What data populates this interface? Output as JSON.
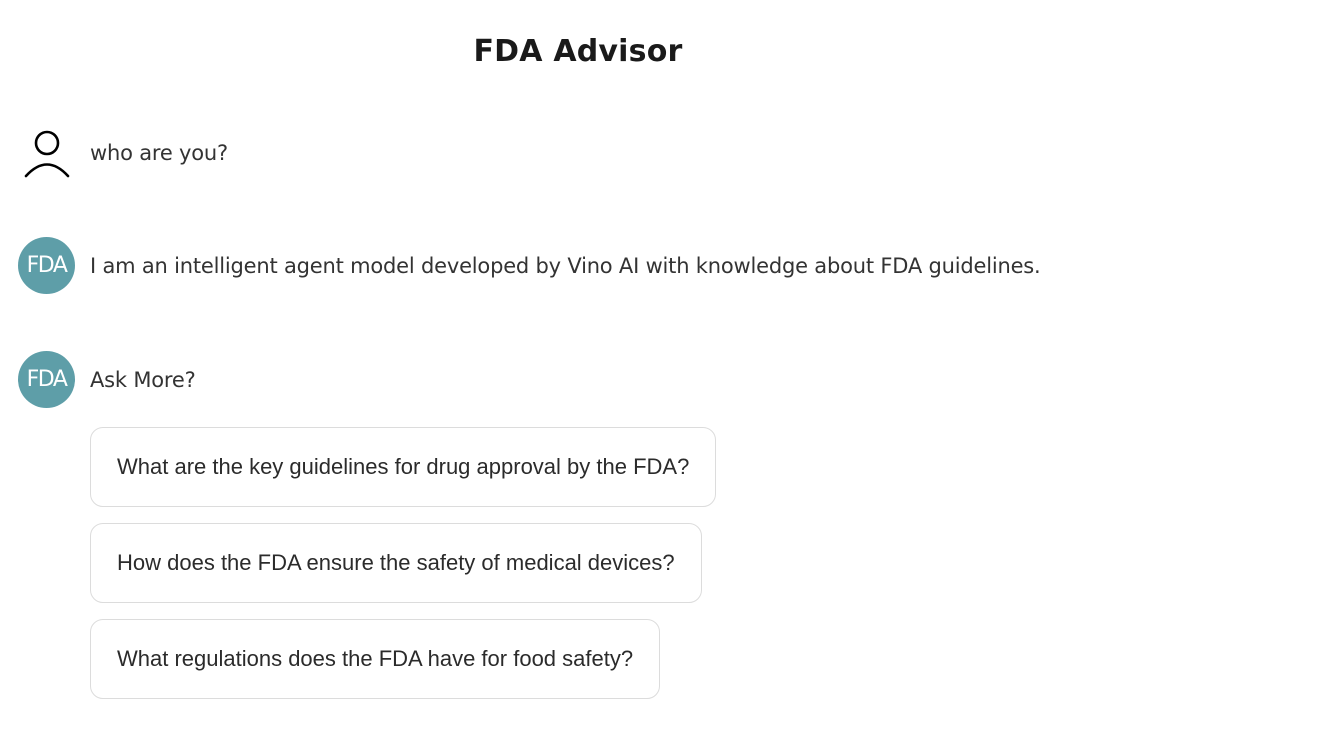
{
  "app": {
    "title": "FDA Advisor"
  },
  "conversation": [
    {
      "role": "user",
      "avatar_icon": "person-icon",
      "text": "who are you?"
    },
    {
      "role": "assistant",
      "avatar_label": "FDA",
      "text": "I am an intelligent agent model developed by Vino AI with knowledge about FDA guidelines."
    },
    {
      "role": "assistant",
      "avatar_label": "FDA",
      "text": "Ask More?"
    }
  ],
  "suggestions": [
    "What are the key guidelines for drug approval by the FDA?",
    "How does the FDA ensure the safety of medical devices?",
    "What regulations does the FDA have for food safety?"
  ],
  "colors": {
    "assistant_avatar_bg": "#5e9ea8",
    "assistant_avatar_text": "#ffffff",
    "suggestion_border": "#dcdcdc"
  }
}
